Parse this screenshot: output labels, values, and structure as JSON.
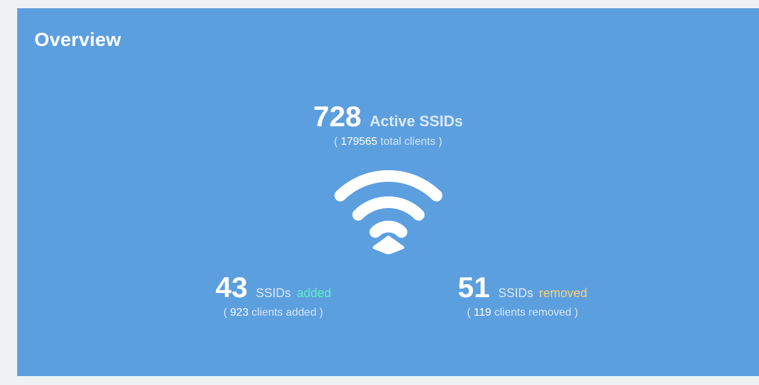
{
  "overview": {
    "title": "Overview",
    "active": {
      "count": "728",
      "label": "Active SSIDs",
      "paren_open": "( ",
      "total_clients": "179565",
      "total_clients_suffix": " total clients )"
    },
    "added": {
      "count": "43",
      "label": "SSIDs",
      "status": "added",
      "paren_open": "( ",
      "clients": "923",
      "clients_suffix": " clients added )"
    },
    "removed": {
      "count": "51",
      "label": "SSIDs",
      "status": "removed",
      "paren_open": "( ",
      "clients": "119",
      "clients_suffix": " clients removed )"
    },
    "icon": "wifi-icon",
    "colors": {
      "card": "#5c9fdf",
      "added": "#5ff0c9",
      "removed": "#f7d27a",
      "text": "#ffffff"
    }
  }
}
